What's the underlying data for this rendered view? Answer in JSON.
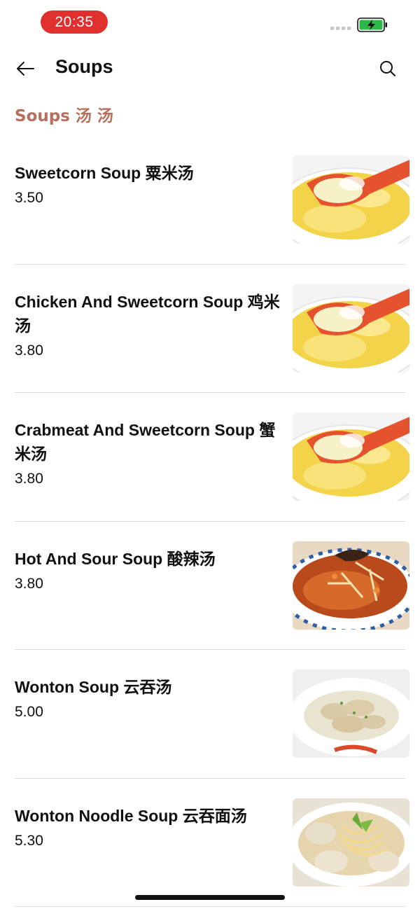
{
  "status_bar": {
    "time": "20:35"
  },
  "header": {
    "title": "Soups",
    "back_icon": "arrow-left-icon",
    "search_icon": "search-icon"
  },
  "section": {
    "title": "Soups 汤 汤"
  },
  "items": [
    {
      "name": "Sweetcorn Soup 粟米汤",
      "price": "3.50",
      "image": "sweetcorn"
    },
    {
      "name": "Chicken And Sweetcorn Soup 鸡米汤",
      "price": "3.80",
      "image": "sweetcorn"
    },
    {
      "name": "Crabmeat And Sweetcorn Soup 蟹米汤",
      "price": "3.80",
      "image": "sweetcorn"
    },
    {
      "name": "Hot And Sour Soup 酸辣汤",
      "price": "3.80",
      "image": "hot-sour"
    },
    {
      "name": "Wonton Soup 云吞汤",
      "price": "5.00",
      "image": "wonton"
    },
    {
      "name": "Wonton Noodle Soup 云吞面汤",
      "price": "5.30",
      "image": "wonton-noodle"
    }
  ],
  "colors": {
    "accent": "#b66f5c",
    "time_pill": "#e0302d",
    "battery": "#2fb84a"
  }
}
